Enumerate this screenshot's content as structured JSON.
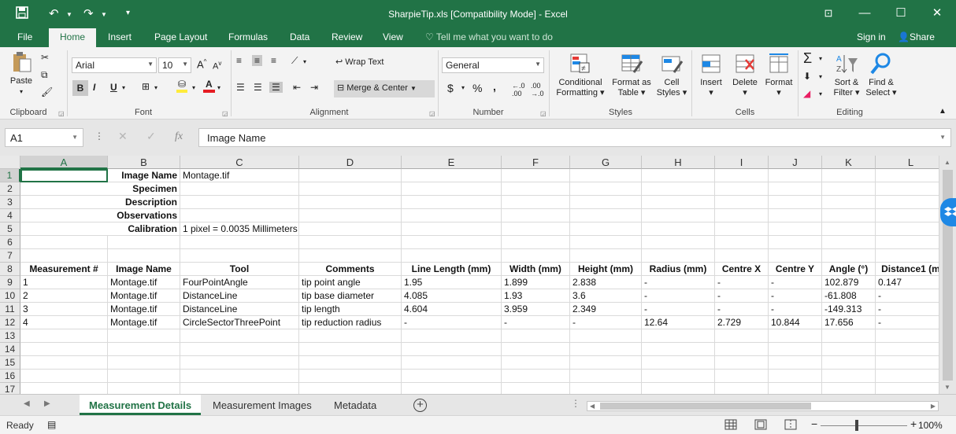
{
  "window": {
    "title": "SharpieTip.xls  [Compatibility Mode] - Excel"
  },
  "ribbon_tabs": [
    "File",
    "Home",
    "Insert",
    "Page Layout",
    "Formulas",
    "Data",
    "Review",
    "View"
  ],
  "tell_me": "Tell me what you want to do",
  "account": {
    "sign_in": "Sign in",
    "share": "Share"
  },
  "ribbon": {
    "clipboard": {
      "paste": "Paste",
      "label": "Clipboard"
    },
    "font": {
      "name": "Arial",
      "size": "10",
      "label": "Font"
    },
    "alignment": {
      "wrap": "Wrap Text",
      "merge": "Merge & Center",
      "label": "Alignment"
    },
    "number": {
      "format": "General",
      "label": "Number"
    },
    "styles": {
      "conditional": [
        "Conditional",
        "Formatting"
      ],
      "format_table": [
        "Format as",
        "Table"
      ],
      "cell_styles": [
        "Cell",
        "Styles"
      ],
      "label": "Styles"
    },
    "cells": {
      "insert": "Insert",
      "delete": "Delete",
      "format": "Format",
      "label": "Cells"
    },
    "editing": {
      "sort": [
        "Sort &",
        "Filter"
      ],
      "find": [
        "Find &",
        "Select"
      ],
      "label": "Editing"
    }
  },
  "formula_bar": {
    "name_box": "A1",
    "formula": "Image Name"
  },
  "columns": [
    "A",
    "B",
    "C",
    "D",
    "E",
    "F",
    "G",
    "H",
    "I",
    "J",
    "K",
    "L"
  ],
  "rows": [
    "1",
    "2",
    "3",
    "4",
    "5",
    "6",
    "7",
    "8",
    "9",
    "10",
    "11",
    "12",
    "13",
    "14",
    "15",
    "16",
    "17"
  ],
  "info": [
    {
      "label": "Image Name",
      "value": "Montage.tif"
    },
    {
      "label": "Specimen",
      "value": ""
    },
    {
      "label": "Description",
      "value": ""
    },
    {
      "label": "Observations",
      "value": ""
    },
    {
      "label": "Calibration",
      "value": "1 pixel = 0.0035 Millimeters"
    }
  ],
  "table": {
    "headers": [
      "Measurement #",
      "Image Name",
      "Tool",
      "Comments",
      "Line Length (mm)",
      "Width (mm)",
      "Height (mm)",
      "Radius (mm)",
      "Centre X",
      "Centre Y",
      "Angle (°)",
      "Distance1 (m"
    ],
    "rows": [
      [
        "1",
        "Montage.tif",
        "FourPointAngle",
        "tip point angle",
        "1.95",
        "1.899",
        "2.838",
        "-",
        "-",
        "-",
        "102.879",
        "0.147"
      ],
      [
        "2",
        "Montage.tif",
        "DistanceLine",
        "tip base diameter",
        "4.085",
        "1.93",
        "3.6",
        "-",
        "-",
        "-",
        "-61.808",
        "-"
      ],
      [
        "3",
        "Montage.tif",
        "DistanceLine",
        "tip length",
        "4.604",
        "3.959",
        "2.349",
        "-",
        "-",
        "-",
        "-149.313",
        "-"
      ],
      [
        "4",
        "Montage.tif",
        "CircleSectorThreePoint",
        "tip reduction radius",
        "-",
        "-",
        "-",
        "12.64",
        "2.729",
        "10.844",
        "17.656",
        "-"
      ]
    ]
  },
  "sheets": [
    "Measurement Details",
    "Measurement Images",
    "Metadata"
  ],
  "status": {
    "ready": "Ready",
    "zoom": "100%"
  },
  "colors": {
    "accent": "#217346"
  }
}
